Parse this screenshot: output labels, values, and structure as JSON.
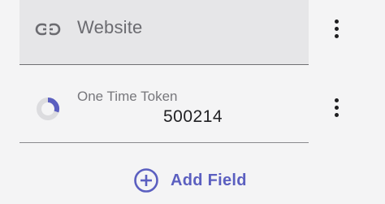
{
  "fields": {
    "website": {
      "label": "Website",
      "icon": "link-icon"
    },
    "one_time_token": {
      "label": "One Time Token",
      "value": "500214",
      "icon": "countdown-timer-icon",
      "timer_remaining_fraction": 0.3
    }
  },
  "actions": {
    "add_field_label": "Add Field",
    "add_field_icon": "plus-circle-icon",
    "more_icon": "more-vertical-icon"
  },
  "colors": {
    "accent": "#5b5fc0",
    "timer_track": "#dcdcdf",
    "text_primary": "#1f1f22",
    "text_secondary": "#6b6b70"
  }
}
